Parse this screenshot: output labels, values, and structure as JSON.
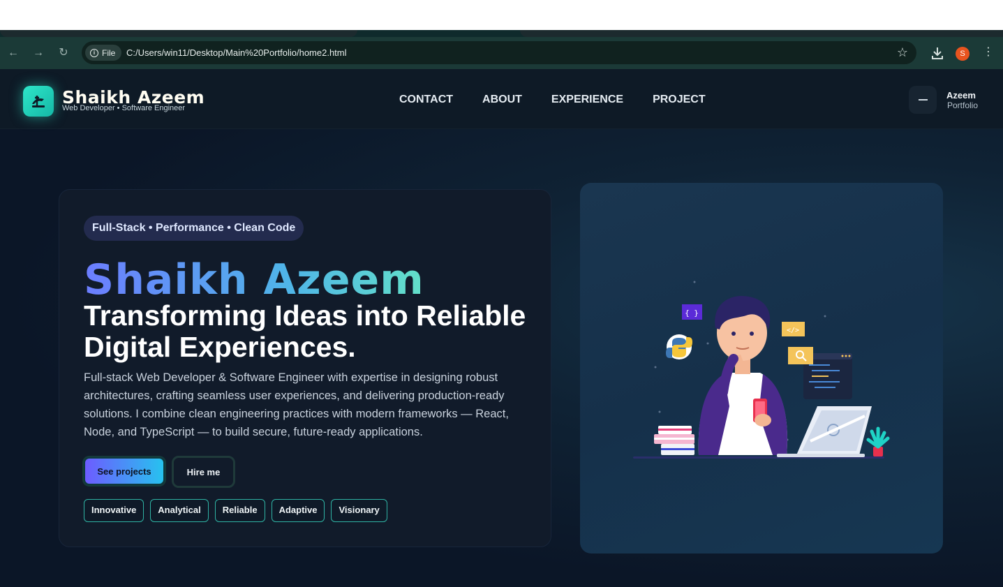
{
  "browser": {
    "address": {
      "scheme_label": "File",
      "url": "C:/Users/win11/Desktop/Main%20Portfolio/home2.html"
    },
    "profile_initial": "S"
  },
  "header": {
    "brand_name": "Shaikh Azeem",
    "brand_tagline": "Web Developer • Software Engineer",
    "nav": [
      "CONTACT",
      "ABOUT",
      "EXPERIENCE",
      "PROJECT"
    ],
    "owner_name": "Azeem",
    "owner_sub": "Portfolio"
  },
  "hero": {
    "pill": "Full-Stack • Performance • Clean Code",
    "name": "Shaikh Azeem",
    "title": "Transforming Ideas into Reliable Digital Experiences.",
    "description": "Full-stack Web Developer & Software Engineer with expertise in designing robust architectures, crafting seamless user experiences, and delivering production-ready solutions. I combine clean engineering practices with modern frameworks — React, Node, and TypeScript — to build secure, future-ready applications.",
    "primary_button": "See projects",
    "secondary_button": "Hire me",
    "traits": [
      "Innovative",
      "Analytical",
      "Reliable",
      "Adaptive",
      "Visionary"
    ]
  },
  "illustration": {
    "badge_braces": "{ }",
    "badge_code": "</>"
  },
  "colors": {
    "accent_teal": "#2ee6c9",
    "gradient_start": "#6d5cff",
    "gradient_end": "#27c2ef",
    "page_bg": "#0b1320"
  }
}
